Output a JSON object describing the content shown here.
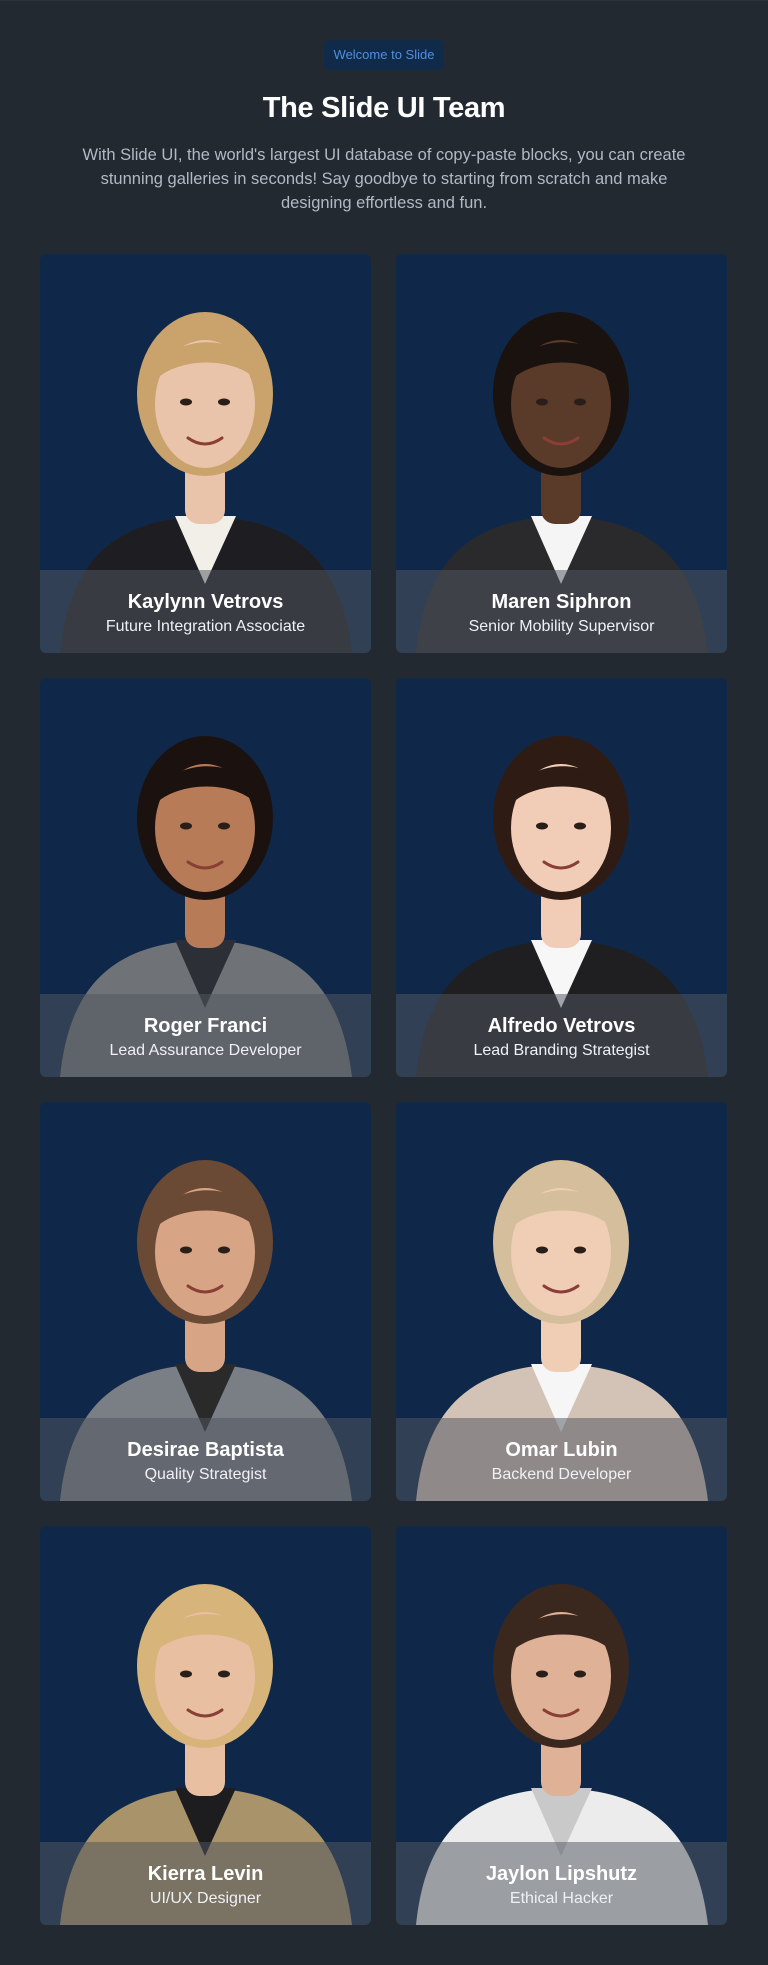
{
  "header": {
    "badge": "Welcome to Slide",
    "title": "The Slide UI Team",
    "subtitle": "With Slide UI, the world's largest UI database of copy-paste blocks, you can create stunning galleries in seconds! Say goodbye to starting from scratch and make designing effortless and fun."
  },
  "colors": {
    "page_background": "#222931",
    "card_background": "#0f284a",
    "badge_background": "#102a4a",
    "badge_text": "#4f8fe0",
    "subtitle_text": "#b3b9c2"
  },
  "team": [
    {
      "name": "Kaylynn Vetrovs",
      "role": "Future Integration Associate",
      "hair": "#c9a36b",
      "skin": "#e9c4aa",
      "outfit": "#1e1e22",
      "accent": "#f2efe8"
    },
    {
      "name": "Maren Siphron",
      "role": "Senior Mobility Supervisor",
      "hair": "#1a120e",
      "skin": "#5a3a28",
      "outfit": "#2a2a2c",
      "accent": "#f5f5f5"
    },
    {
      "name": "Roger Franci",
      "role": "Lead Assurance Developer",
      "hair": "#1b1210",
      "skin": "#b77b58",
      "outfit": "#6f7378",
      "accent": "#2c3036"
    },
    {
      "name": "Alfredo Vetrovs",
      "role": "Lead Branding Strategist",
      "hair": "#2e1c14",
      "skin": "#f1cdb7",
      "outfit": "#1f1f22",
      "accent": "#f7f7f7"
    },
    {
      "name": "Desirae Baptista",
      "role": "Quality Strategist",
      "hair": "#6a4a34",
      "skin": "#d8a486",
      "outfit": "#7a7e85",
      "accent": "#2a2a2a"
    },
    {
      "name": "Omar Lubin",
      "role": "Backend Developer",
      "hair": "#d4be9c",
      "skin": "#f0cdb5",
      "outfit": "#d3c3b6",
      "accent": "#f6f6f6"
    },
    {
      "name": "Kierra Levin",
      "role": "UI/UX Designer",
      "hair": "#d6b47a",
      "skin": "#e8bfa0",
      "outfit": "#a8936a",
      "accent": "#1d1d1f"
    },
    {
      "name": "Jaylon Lipshutz",
      "role": "Ethical Hacker",
      "hair": "#3a281e",
      "skin": "#dfb196",
      "outfit": "#ececec",
      "accent": "#c9c9c9"
    }
  ]
}
